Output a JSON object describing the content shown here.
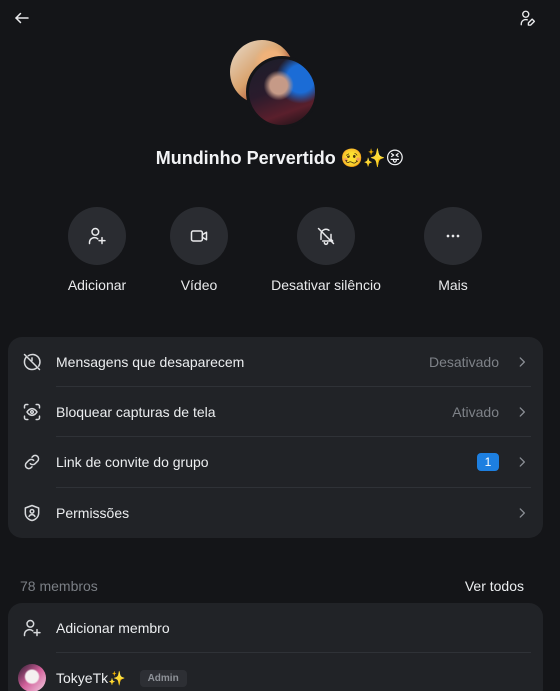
{
  "header": {
    "back_icon": "arrow-left-icon",
    "edit_icon": "person-edit-icon"
  },
  "group": {
    "title": "Mundinho Pervertido 🥴✨😝"
  },
  "actions": [
    {
      "label": "Adicionar",
      "icon": "person-add-icon"
    },
    {
      "label": "Vídeo",
      "icon": "video-camera-icon"
    },
    {
      "label": "Desativar silêncio",
      "icon": "bell-off-icon"
    },
    {
      "label": "Mais",
      "icon": "more-horizontal-icon"
    }
  ],
  "settings": [
    {
      "label": "Mensagens que desaparecem",
      "value": "Desativado",
      "icon": "timer-off-icon"
    },
    {
      "label": "Bloquear capturas de tela",
      "value": "Ativado",
      "icon": "screenshot-eye-icon"
    },
    {
      "label": "Link de convite do grupo",
      "badge": "1",
      "icon": "link-icon"
    },
    {
      "label": "Permissões",
      "value": "",
      "icon": "shield-person-icon"
    }
  ],
  "members": {
    "count_label": "78 membros",
    "see_all_label": "Ver todos",
    "add_label": "Adicionar membro",
    "list": [
      {
        "name": "TokyeTk✨",
        "role": "Admin"
      }
    ]
  },
  "colors": {
    "background": "#141518",
    "card": "#212327",
    "action_circle": "#2a2c31",
    "badge": "#1d7fe0"
  }
}
